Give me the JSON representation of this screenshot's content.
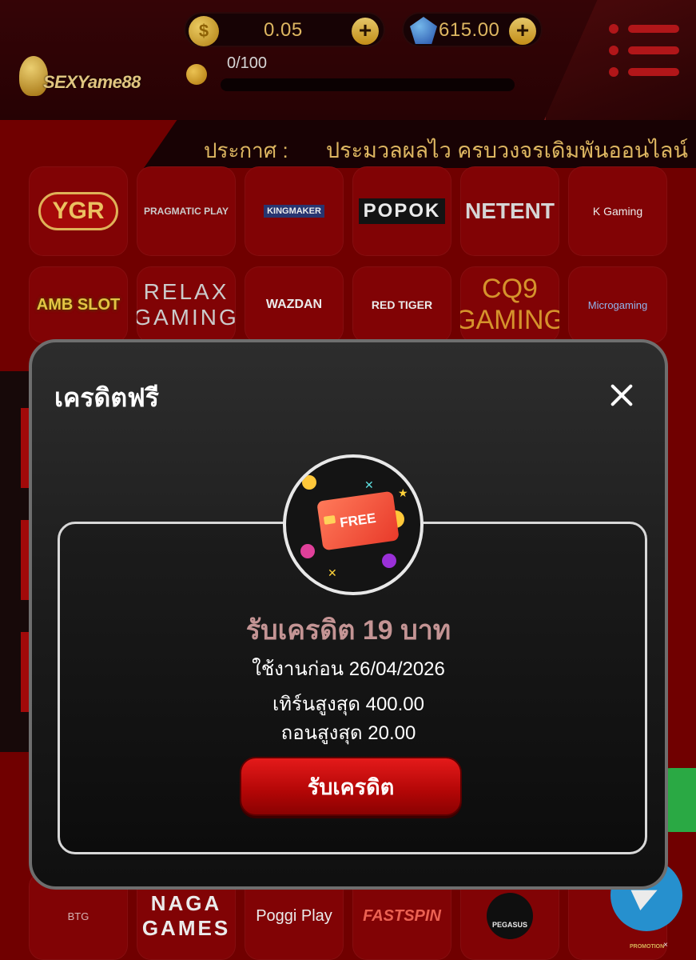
{
  "header": {
    "logo_text": "SEXYame88",
    "coin_balance": "0.05",
    "gem_balance": "615.00",
    "level_progress_text": "0/100",
    "level_progress_fraction": 0,
    "plus_label": "+",
    "coin_symbol": "$"
  },
  "announcement": {
    "label": "ประกาศ :",
    "text": "ประมวลผลไว ครบวงจรเดิมพันออนไลน์"
  },
  "providers": {
    "row1": [
      "YGR",
      "PRAGMATIC PLAY",
      "KINGMAKER",
      "POPOK",
      "NETENT",
      "K Gaming"
    ],
    "row2": [
      "AMB SLOT",
      "RELAX GAMING",
      "WAZDAN",
      "RED TIGER",
      "CQ9 GAMING",
      "Microgaming"
    ],
    "row3": [
      "BTG",
      "NAGA GAMES",
      "Poggi Play",
      "FASTSPIN",
      "PEGASUS",
      ""
    ]
  },
  "modal": {
    "title": "เครดิตฟรี",
    "badge_text": "FREE",
    "offer_title": "รับเครดิต 19 บาท",
    "expiry": "ใช้งานก่อน 26/04/2026",
    "max_turnover": "เทิร์นสูงสุด 400.00",
    "max_withdraw": "ถอนสูงสุด 20.00",
    "claim_button": "รับเครดิต"
  },
  "corner_promo": {
    "label": "PROMOTION",
    "close": "×"
  },
  "colors": {
    "background": "#7a0000",
    "header": "#2a0305",
    "accent_gold": "#f0c66a",
    "modal_bg": "#1a1a1a",
    "claim_button": "#d41010",
    "offer_title": "#c49494"
  }
}
